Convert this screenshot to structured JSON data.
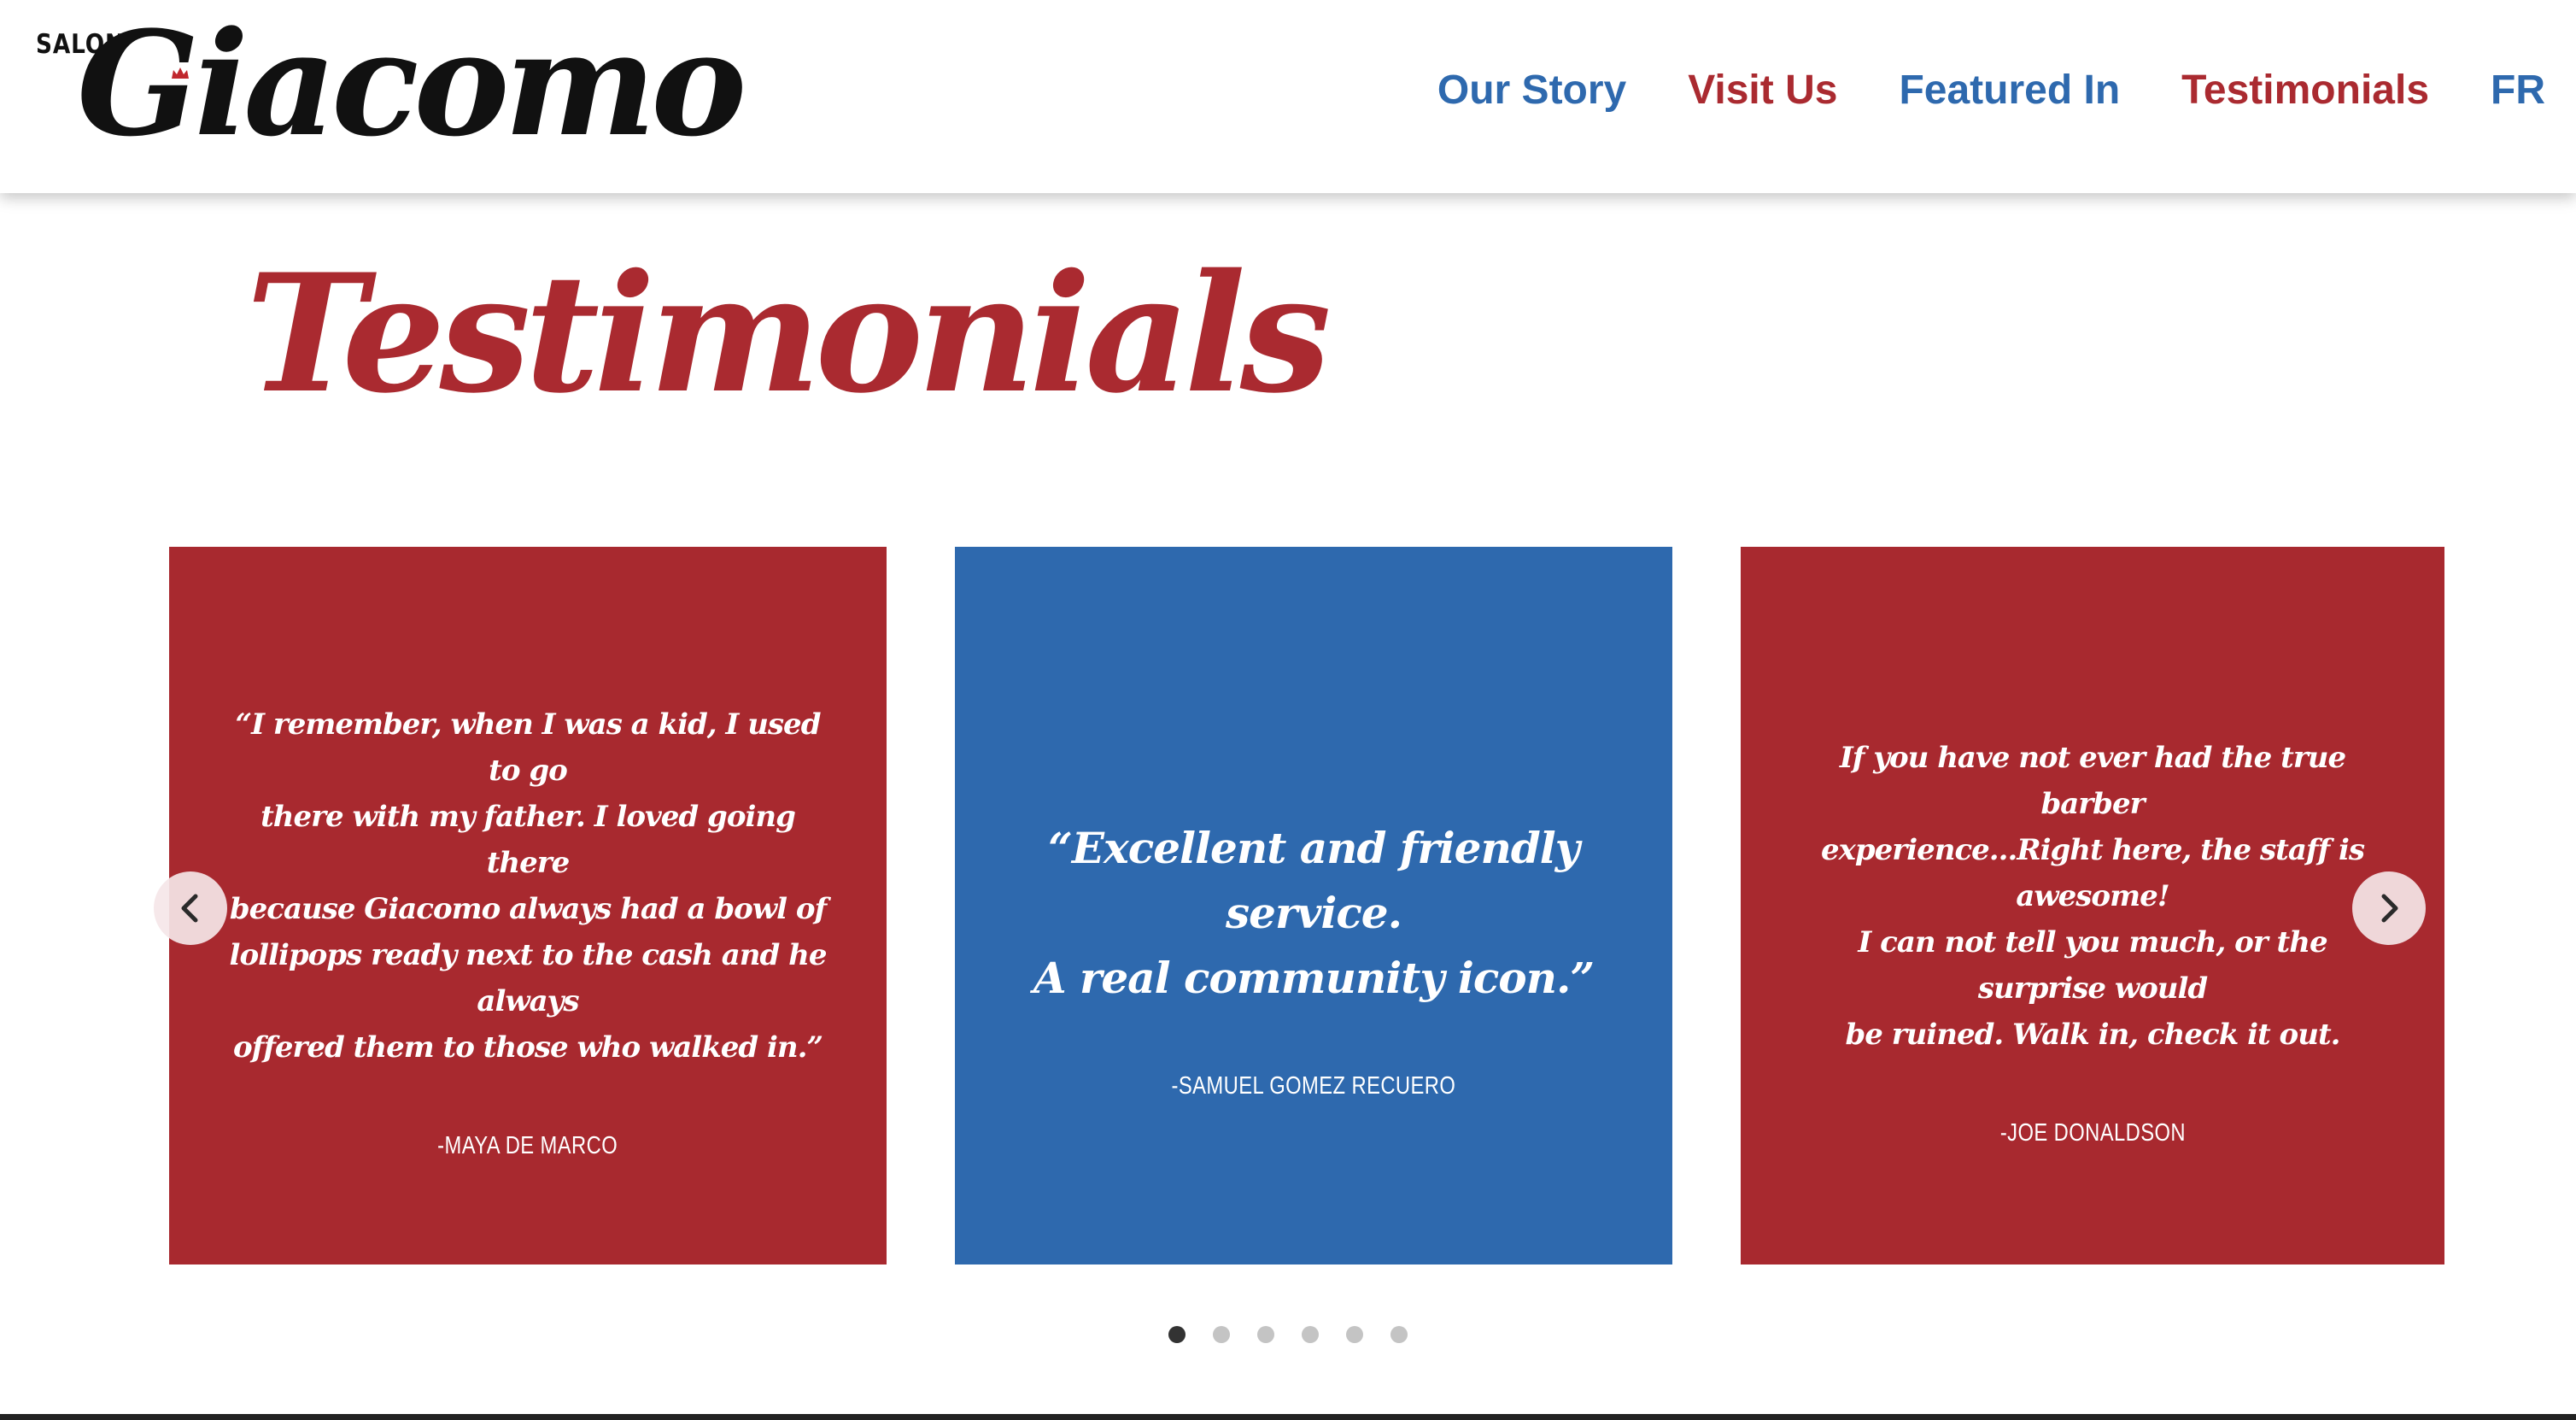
{
  "header": {
    "logo_small": "SALON",
    "logo_main": "Giacomo",
    "nav": [
      {
        "label": "Our Story",
        "color": "#2e69ae"
      },
      {
        "label": "Visit Us",
        "color": "#aa2a30"
      },
      {
        "label": "Featured In",
        "color": "#2e69ae"
      },
      {
        "label": "Testimonials",
        "color": "#aa2a30"
      },
      {
        "label": "FR",
        "color": "#2e69ae"
      }
    ]
  },
  "page": {
    "title": "Testimonials"
  },
  "testimonials": [
    {
      "lines": [
        "“I remember, when I was a kid, I used to go",
        "there with my father. I loved going there",
        "because Giacomo always had a bowl of",
        "lollipops ready next to the cash and he always",
        "offered them to those who walked in.”"
      ],
      "author": "-MAYA DE MARCO",
      "color": "#a8292f"
    },
    {
      "lines": [
        "“Excellent and friendly service.",
        "A real community icon.”"
      ],
      "author": "-SAMUEL GOMEZ RECUERO",
      "color": "#2e69ae"
    },
    {
      "lines": [
        "If you have not ever had the true barber",
        "experience...Right here, the staff is awesome!",
        "I can not tell you much, or the surprise would",
        "be ruined. Walk in, check it out."
      ],
      "author": "-JOE DONALDSON",
      "color": "#a8292f"
    }
  ],
  "carousel": {
    "prev_icon": "chevron-left-icon",
    "next_icon": "chevron-right-icon",
    "dot_count": 6,
    "active_index": 0
  },
  "colors": {
    "brand_red": "#aa2a30",
    "brand_blue": "#2e69ae",
    "logo_black": "#111111"
  }
}
